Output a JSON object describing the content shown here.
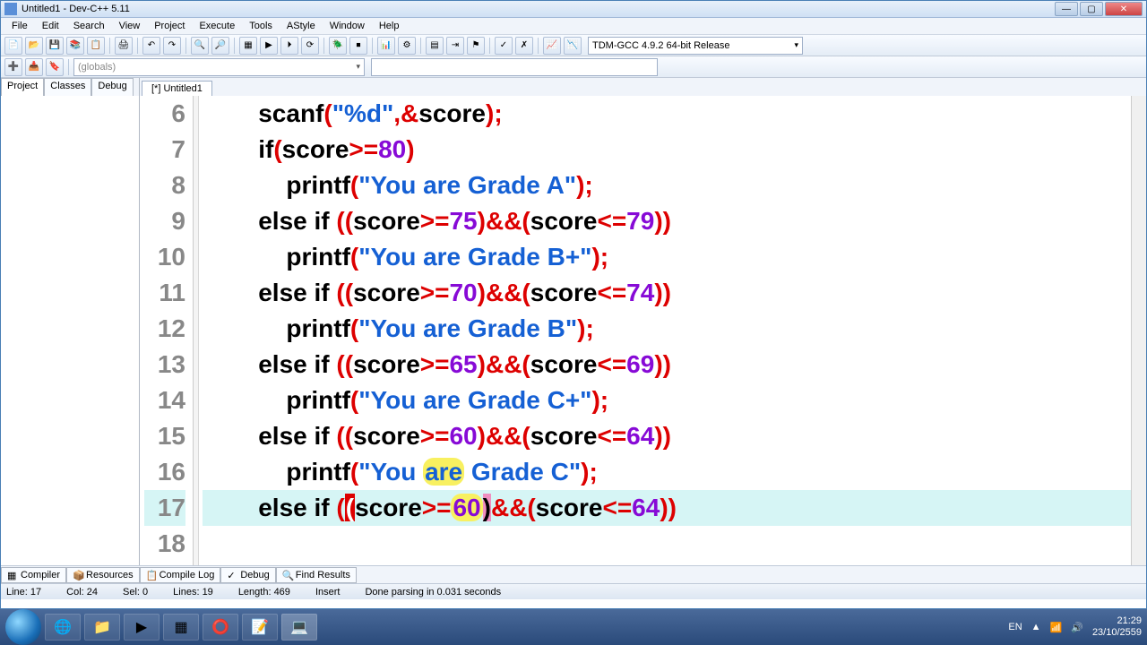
{
  "window": {
    "title": "Untitled1 - Dev-C++ 5.11"
  },
  "menu": {
    "items": [
      "File",
      "Edit",
      "Search",
      "View",
      "Project",
      "Execute",
      "Tools",
      "AStyle",
      "Window",
      "Help"
    ]
  },
  "toolbar": {
    "compiler": "TDM-GCC 4.9.2 64-bit Release",
    "scope": "(globals)"
  },
  "leftPanel": {
    "tabs": [
      "Project",
      "Classes",
      "Debug"
    ]
  },
  "fileTabs": {
    "items": [
      "[*] Untitled1"
    ]
  },
  "code": {
    "startLine": 6,
    "highlightLine": 17,
    "lines": [
      {
        "indent": 2,
        "tokens": [
          {
            "t": "fn",
            "v": "scanf"
          },
          {
            "t": "paren-r",
            "v": "("
          },
          {
            "t": "str",
            "v": "\"%d\""
          },
          {
            "t": "op",
            "v": ",&"
          },
          {
            "t": "fn",
            "v": "score"
          },
          {
            "t": "paren-r",
            "v": ")"
          },
          {
            "t": "semi",
            "v": ";"
          }
        ]
      },
      {
        "indent": 2,
        "tokens": [
          {
            "t": "kw",
            "v": "if"
          },
          {
            "t": "paren-r",
            "v": "("
          },
          {
            "t": "fn",
            "v": "score"
          },
          {
            "t": "op",
            "v": ">="
          },
          {
            "t": "num",
            "v": "80"
          },
          {
            "t": "paren-r",
            "v": ")"
          }
        ]
      },
      {
        "indent": 4,
        "tokens": [
          {
            "t": "fn",
            "v": "printf"
          },
          {
            "t": "paren-r",
            "v": "("
          },
          {
            "t": "str",
            "v": "\"You are Grade A\""
          },
          {
            "t": "paren-r",
            "v": ")"
          },
          {
            "t": "semi",
            "v": ";"
          }
        ]
      },
      {
        "indent": 2,
        "tokens": [
          {
            "t": "kw",
            "v": "else if "
          },
          {
            "t": "paren-r",
            "v": "(("
          },
          {
            "t": "fn",
            "v": "score"
          },
          {
            "t": "op",
            "v": ">="
          },
          {
            "t": "num",
            "v": "75"
          },
          {
            "t": "paren-r",
            "v": ")"
          },
          {
            "t": "op",
            "v": "&&"
          },
          {
            "t": "paren-r",
            "v": "("
          },
          {
            "t": "fn",
            "v": "score"
          },
          {
            "t": "op",
            "v": "<="
          },
          {
            "t": "num",
            "v": "79"
          },
          {
            "t": "paren-r",
            "v": "))"
          }
        ]
      },
      {
        "indent": 4,
        "tokens": [
          {
            "t": "fn",
            "v": "printf"
          },
          {
            "t": "paren-r",
            "v": "("
          },
          {
            "t": "str",
            "v": "\"You are Grade B+\""
          },
          {
            "t": "paren-r",
            "v": ")"
          },
          {
            "t": "semi",
            "v": ";"
          }
        ]
      },
      {
        "indent": 2,
        "tokens": [
          {
            "t": "kw",
            "v": "else if "
          },
          {
            "t": "paren-r",
            "v": "(("
          },
          {
            "t": "fn",
            "v": "score"
          },
          {
            "t": "op",
            "v": ">="
          },
          {
            "t": "num",
            "v": "70"
          },
          {
            "t": "paren-r",
            "v": ")"
          },
          {
            "t": "op",
            "v": "&&"
          },
          {
            "t": "paren-r",
            "v": "("
          },
          {
            "t": "fn",
            "v": "score"
          },
          {
            "t": "op",
            "v": "<="
          },
          {
            "t": "num",
            "v": "74"
          },
          {
            "t": "paren-r",
            "v": "))"
          }
        ]
      },
      {
        "indent": 4,
        "tokens": [
          {
            "t": "fn",
            "v": "printf"
          },
          {
            "t": "paren-r",
            "v": "("
          },
          {
            "t": "str",
            "v": "\"You are Grade B\""
          },
          {
            "t": "paren-r",
            "v": ")"
          },
          {
            "t": "semi",
            "v": ";"
          }
        ]
      },
      {
        "indent": 2,
        "tokens": [
          {
            "t": "kw",
            "v": "else if "
          },
          {
            "t": "paren-r",
            "v": "(("
          },
          {
            "t": "fn",
            "v": "score"
          },
          {
            "t": "op",
            "v": ">="
          },
          {
            "t": "num",
            "v": "65"
          },
          {
            "t": "paren-r",
            "v": ")"
          },
          {
            "t": "op",
            "v": "&&"
          },
          {
            "t": "paren-r",
            "v": "("
          },
          {
            "t": "fn",
            "v": "score"
          },
          {
            "t": "op",
            "v": "<="
          },
          {
            "t": "num",
            "v": "69"
          },
          {
            "t": "paren-r",
            "v": "))"
          }
        ]
      },
      {
        "indent": 4,
        "tokens": [
          {
            "t": "fn",
            "v": "printf"
          },
          {
            "t": "paren-r",
            "v": "("
          },
          {
            "t": "str",
            "v": "\"You are Grade C+\""
          },
          {
            "t": "paren-r",
            "v": ")"
          },
          {
            "t": "semi",
            "v": ";"
          }
        ]
      },
      {
        "indent": 2,
        "tokens": [
          {
            "t": "kw",
            "v": "else if "
          },
          {
            "t": "paren-r",
            "v": "(("
          },
          {
            "t": "fn",
            "v": "score"
          },
          {
            "t": "op",
            "v": ">="
          },
          {
            "t": "num",
            "v": "60"
          },
          {
            "t": "paren-r",
            "v": ")"
          },
          {
            "t": "op",
            "v": "&&"
          },
          {
            "t": "paren-r",
            "v": "("
          },
          {
            "t": "fn",
            "v": "score"
          },
          {
            "t": "op",
            "v": "<="
          },
          {
            "t": "num",
            "v": "64"
          },
          {
            "t": "paren-r",
            "v": "))"
          }
        ]
      },
      {
        "indent": 4,
        "tokens": [
          {
            "t": "fn",
            "v": "printf"
          },
          {
            "t": "paren-r",
            "v": "("
          },
          {
            "t": "str",
            "v": "\"You "
          },
          {
            "t": "str yellow-glow",
            "v": "are"
          },
          {
            "t": "str",
            "v": " Grade C\""
          },
          {
            "t": "paren-r",
            "v": ")"
          },
          {
            "t": "semi",
            "v": ";"
          }
        ]
      },
      {
        "indent": 2,
        "tokens": [
          {
            "t": "kw",
            "v": "else if "
          },
          {
            "t": "paren-r",
            "v": "("
          },
          {
            "t": "bracket-hl",
            "v": "("
          },
          {
            "t": "fn",
            "v": "score"
          },
          {
            "t": "op",
            "v": ">="
          },
          {
            "t": "num yellow-glow",
            "v": "60"
          },
          {
            "t": "cursor-hl",
            "v": ")"
          },
          {
            "t": "op",
            "v": "&&"
          },
          {
            "t": "paren-r",
            "v": "("
          },
          {
            "t": "fn",
            "v": "score"
          },
          {
            "t": "op",
            "v": "<="
          },
          {
            "t": "num",
            "v": "64"
          },
          {
            "t": "paren-r",
            "v": "))"
          }
        ]
      },
      {
        "indent": 0,
        "tokens": []
      }
    ]
  },
  "bottomTabs": {
    "items": [
      "Compiler",
      "Resources",
      "Compile Log",
      "Debug",
      "Find Results"
    ]
  },
  "status": {
    "line": "Line:   17",
    "col": "Col:   24",
    "sel": "Sel:   0",
    "lines": "Lines:   19",
    "length": "Length:   469",
    "insert": "Insert",
    "parse": "Done parsing in 0.031 seconds"
  },
  "taskbar": {
    "lang": "EN",
    "time": "21:29",
    "date": "23/10/2559"
  }
}
